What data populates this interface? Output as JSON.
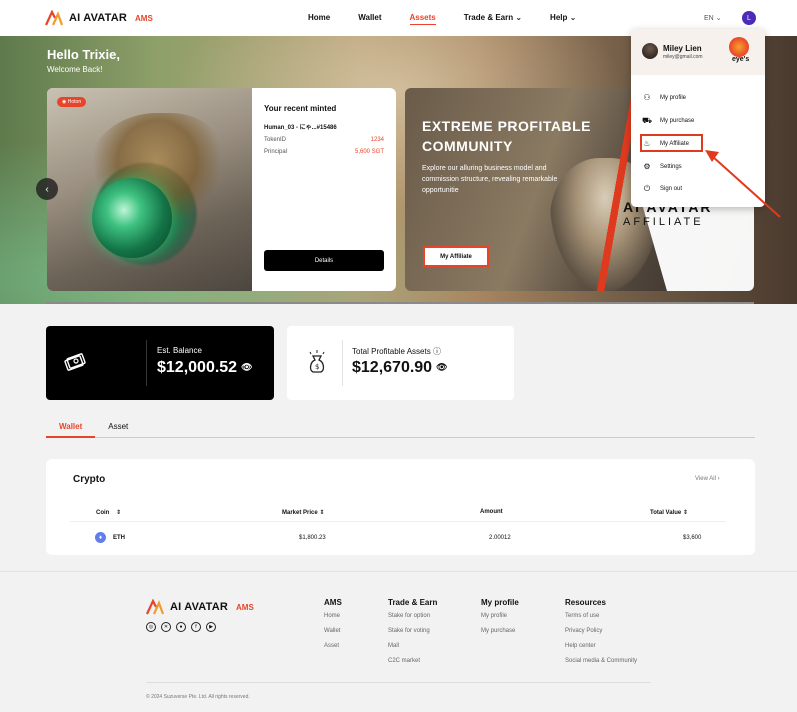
{
  "nav": {
    "logo_text": "AI AVATAR",
    "logo_badge": "AMS",
    "links": [
      "Home",
      "Wallet",
      "Assets",
      "Trade & Earn",
      "Help"
    ],
    "active_link": "Assets",
    "lang": "EN",
    "avatar_letter": "L"
  },
  "hero": {
    "greeting": "Hello Trixie,",
    "welcome": "Welcome Back!",
    "nft": {
      "badge": "Hoton",
      "title": "Your recent minted",
      "name": "Human_03 - にゃ...#15486",
      "token_label": "TokenID",
      "token_value": "1234",
      "principal_label": "Principal",
      "principal_value": "5,600 SGT",
      "details_btn": "Details"
    },
    "affiliate": {
      "title": "EXTREME PROFITABLE COMMUNITY",
      "desc": "Explore our alluring business model and commission structure, revealing remarkable opportunitie",
      "button": "My Affiliate",
      "brand_line1": "AI AVATAR",
      "brand_line2": "AFFILIATE"
    }
  },
  "balance": {
    "label": "Est. Balance",
    "value": "$12,000.52"
  },
  "profitable": {
    "label": "Total Profitable Assets",
    "value": "$12,670.90"
  },
  "tabs": [
    "Wallet",
    "Asset"
  ],
  "active_tab": "Wallet",
  "crypto": {
    "title": "Crypto",
    "view_all": "View All",
    "headers": [
      "Coin",
      "Market Price",
      "Amount",
      "Total Value"
    ],
    "rows": [
      {
        "coin": "ETH",
        "price": "$1,800.23",
        "amount": "2.00012",
        "total": "$3,600"
      }
    ]
  },
  "footer": {
    "logo_text": "AI AVATAR",
    "logo_badge": "AMS",
    "columns": [
      {
        "heading": "AMS",
        "items": [
          "Home",
          "Wallet",
          "Asset"
        ]
      },
      {
        "heading": "Trade & Earn",
        "items": [
          "Stake for option",
          "Stake for voting",
          "Mall",
          "C2C market"
        ]
      },
      {
        "heading": "My profile",
        "items": [
          "My profile",
          "My purchase"
        ]
      },
      {
        "heading": "Resources",
        "items": [
          "Terms of use",
          "Privacy Policy",
          "Help center",
          "Social media & Community"
        ]
      }
    ],
    "copyright": "© 2024 Suzuverse Pte. Ltd. All rights reserved."
  },
  "dropdown": {
    "name": "Miley Lien",
    "email": "miley@gmail.com",
    "brand": "eye's",
    "items": [
      "My profile",
      "My purchase",
      "My Affiliate",
      "Settings",
      "Sign out"
    ]
  },
  "colors": {
    "accent": "#e8442a",
    "dark": "#000000"
  }
}
